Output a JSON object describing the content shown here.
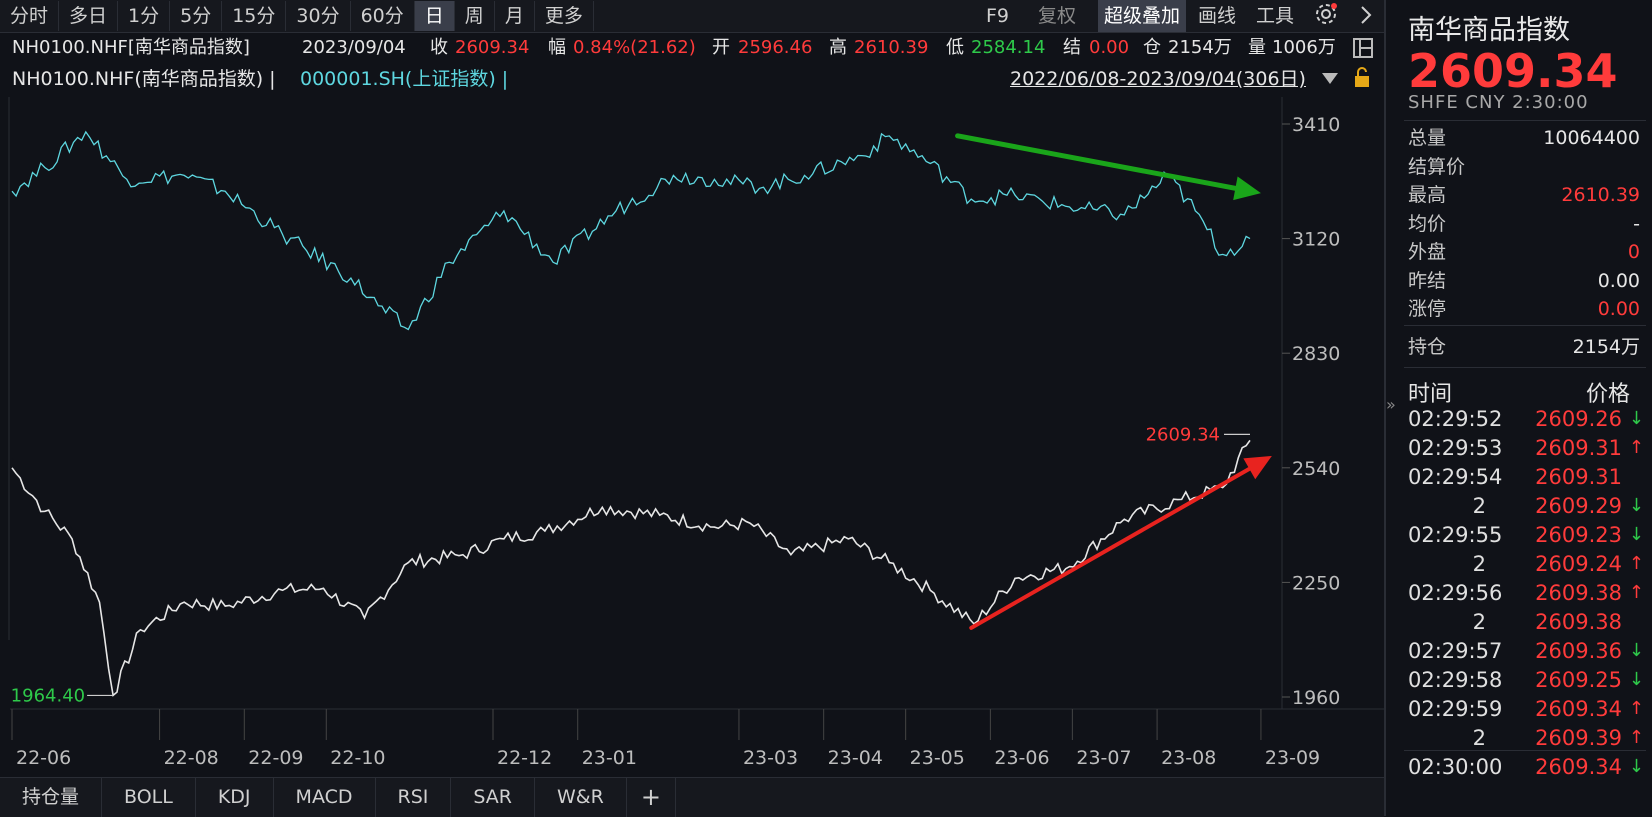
{
  "toolbar": {
    "periods": [
      "分时",
      "多日",
      "1分",
      "5分",
      "15分",
      "30分",
      "60分",
      "日",
      "周",
      "月",
      "更多"
    ],
    "active_period": "日",
    "right": {
      "f9": "F9",
      "fuquan": "复权",
      "overlay": "超级叠加",
      "draw": "画线",
      "tools": "工具",
      "settings_icon": "gear-icon",
      "more_icon": "chevron-right-icon"
    }
  },
  "info": {
    "code": "NH0100.NHF[南华商品指数]",
    "date": "2023/09/04",
    "close_label": "收",
    "close": "2609.34",
    "change_label": "幅",
    "change": "0.84%(21.62)",
    "open_label": "开",
    "open": "2596.46",
    "high_label": "高",
    "high": "2610.39",
    "low_label": "低",
    "low": "2584.14",
    "settle_label": "结",
    "settle": "0.00",
    "oi_label": "仓",
    "oi": "2154万",
    "vol_label": "量",
    "vol": "1006万"
  },
  "legend": {
    "main": "NH0100.NHF(南华商品指数) |",
    "overlay": "000001.SH(上证指数) |",
    "range": "2022/06/08-2023/09/04(306日)"
  },
  "chart_data": {
    "type": "line",
    "yticks": [
      "3410",
      "3120",
      "2830",
      "2540",
      "2250",
      "1960"
    ],
    "ylim": [
      1960,
      3410
    ],
    "xticks": [
      "22-06",
      "22-08",
      "22-09",
      "22-10",
      "22-12",
      "23-01",
      "23-03",
      "23-04",
      "23-05",
      "23-06",
      "23-07",
      "23-08",
      "23-09"
    ],
    "series": [
      {
        "name": "NH0100.NHF(南华商品指数)",
        "color": "#e6e6e6",
        "x": [
          "2022-06-08",
          "2022-06-20",
          "2022-06-30",
          "2022-07-10",
          "2022-07-15",
          "2022-07-25",
          "2022-08-10",
          "2022-08-25",
          "2022-09-15",
          "2022-09-30",
          "2022-10-15",
          "2022-10-31",
          "2022-11-20",
          "2022-12-05",
          "2022-12-20",
          "2023-01-10",
          "2023-01-31",
          "2023-02-20",
          "2023-03-05",
          "2023-03-20",
          "2023-04-10",
          "2023-04-25",
          "2023-05-10",
          "2023-05-26",
          "2023-06-10",
          "2023-06-30",
          "2023-07-20",
          "2023-08-10",
          "2023-08-25",
          "2023-09-04"
        ],
        "values": [
          2540,
          2430,
          2360,
          2200,
          1964,
          2130,
          2200,
          2190,
          2230,
          2235,
          2160,
          2300,
          2320,
          2360,
          2380,
          2440,
          2420,
          2390,
          2400,
          2320,
          2360,
          2300,
          2230,
          2145,
          2260,
          2290,
          2410,
          2460,
          2490,
          2609.34
        ]
      },
      {
        "name": "000001.SH(上证指数)",
        "color": "#5ed7e0",
        "x": [
          "2022-06-08",
          "2022-06-20",
          "2022-07-05",
          "2022-07-20",
          "2022-08-10",
          "2022-08-25",
          "2022-09-15",
          "2022-10-10",
          "2022-10-20",
          "2022-10-31",
          "2022-11-15",
          "2022-12-05",
          "2022-12-23",
          "2023-01-15",
          "2023-02-05",
          "2023-02-20",
          "2023-03-10",
          "2023-03-25",
          "2023-04-15",
          "2023-04-25",
          "2023-05-10",
          "2023-05-25",
          "2023-06-10",
          "2023-06-30",
          "2023-07-20",
          "2023-08-05",
          "2023-08-15",
          "2023-08-25",
          "2023-09-04"
        ],
        "values": [
          3240,
          3300,
          3390,
          3270,
          3280,
          3240,
          3130,
          3020,
          2950,
          2890,
          3060,
          3190,
          3060,
          3190,
          3280,
          3270,
          3250,
          3280,
          3330,
          3380,
          3310,
          3220,
          3230,
          3200,
          3180,
          3280,
          3190,
          3080,
          3120
        ]
      }
    ],
    "annotations": [
      {
        "text": "2609.34",
        "color": "#ff3b3b",
        "at": "last"
      },
      {
        "text": "1964.40",
        "color": "#2ec94a",
        "at": "min"
      }
    ],
    "arrows": [
      {
        "color": "#1aa51a",
        "direction": "down",
        "on": "000001.SH"
      },
      {
        "color": "#e8231f",
        "direction": "up",
        "on": "NH0100.NHF"
      }
    ]
  },
  "indicators": [
    "持仓量",
    "BOLL",
    "KDJ",
    "MACD",
    "RSI",
    "SAR",
    "W&R",
    "+"
  ],
  "panel": {
    "title": "南华商品指数",
    "price": "2609.34",
    "sub": "SHFE  CNY  2:30:00",
    "rows": [
      {
        "label": "总量",
        "value": "10064400",
        "color": "#e6e6e6"
      },
      {
        "label": "结算价",
        "value": "",
        "color": "#e6e6e6"
      },
      {
        "label": "最高",
        "value": "2610.39",
        "color": "#ff3b3b"
      },
      {
        "label": "均价",
        "value": "-",
        "color": "#e6e6e6"
      },
      {
        "label": "外盘",
        "value": "0",
        "color": "#ff3b3b"
      },
      {
        "label": "昨结",
        "value": "0.00",
        "color": "#e6e6e6"
      },
      {
        "label": "涨停",
        "value": "0.00",
        "color": "#ff3b3b"
      }
    ],
    "oi_label": "持仓",
    "oi_value": "2154万",
    "trades_header": {
      "time": "时间",
      "price": "价格"
    },
    "trades": [
      {
        "time": "02:29:52",
        "price": "2609.26",
        "dir": "down"
      },
      {
        "time": "02:29:53",
        "price": "2609.31",
        "dir": "up"
      },
      {
        "time": "02:29:54",
        "price": "2609.31",
        "dir": ""
      },
      {
        "time": "2",
        "price": "2609.29",
        "dir": "down"
      },
      {
        "time": "02:29:55",
        "price": "2609.23",
        "dir": "down"
      },
      {
        "time": "2",
        "price": "2609.24",
        "dir": "up"
      },
      {
        "time": "02:29:56",
        "price": "2609.38",
        "dir": "up"
      },
      {
        "time": "2",
        "price": "2609.38",
        "dir": ""
      },
      {
        "time": "02:29:57",
        "price": "2609.36",
        "dir": "down"
      },
      {
        "time": "02:29:58",
        "price": "2609.25",
        "dir": "down"
      },
      {
        "time": "02:29:59",
        "price": "2609.34",
        "dir": "up"
      },
      {
        "time": "2",
        "price": "2609.39",
        "dir": "up"
      },
      {
        "time": "02:30:00",
        "price": "2609.34",
        "dir": "down"
      }
    ]
  }
}
